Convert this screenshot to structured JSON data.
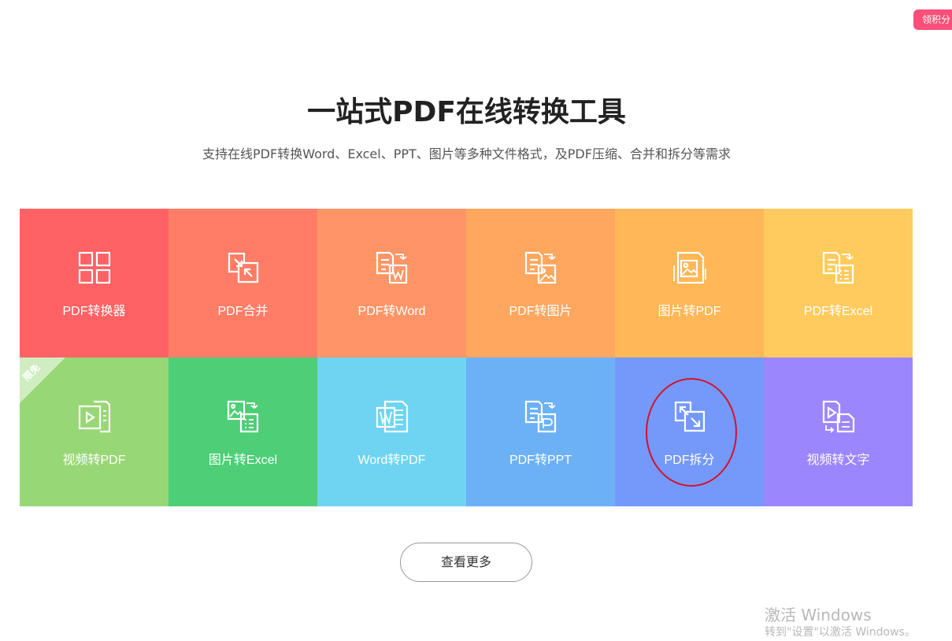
{
  "badge": {
    "label": "领积分"
  },
  "hero": {
    "title": "一站式PDF在线转换工具",
    "subtitle": "支持在线PDF转换Word、Excel、PPT、图片等多种文件格式，及PDF压缩、合并和拆分等需求"
  },
  "tools": [
    {
      "label": "PDF转换器",
      "icon": "grid-icon",
      "color": "#ff6264"
    },
    {
      "label": "PDF合并",
      "icon": "merge-icon",
      "color": "#ff7d67"
    },
    {
      "label": "PDF转Word",
      "icon": "pdf-to-word-icon",
      "color": "#ff9566"
    },
    {
      "label": "PDF转图片",
      "icon": "pdf-to-image-icon",
      "color": "#ffa75f"
    },
    {
      "label": "图片转PDF",
      "icon": "image-to-pdf-icon",
      "color": "#ffb757"
    },
    {
      "label": "PDF转Excel",
      "icon": "pdf-to-excel-icon",
      "color": "#ffcb5f"
    },
    {
      "label": "视频转PDF",
      "icon": "video-to-pdf-icon",
      "color": "#98d775",
      "ribbon": "限免"
    },
    {
      "label": "图片转Excel",
      "icon": "image-to-excel-icon",
      "color": "#4ece76"
    },
    {
      "label": "Word转PDF",
      "icon": "word-to-pdf-icon",
      "color": "#6fd4f2"
    },
    {
      "label": "PDF转PPT",
      "icon": "pdf-to-ppt-icon",
      "color": "#6cb1f6"
    },
    {
      "label": "PDF拆分",
      "icon": "split-icon",
      "color": "#7499fb"
    },
    {
      "label": "视频转文字",
      "icon": "video-to-text-icon",
      "color": "#9c86fd"
    }
  ],
  "more_button": {
    "label": "查看更多"
  },
  "watermark": {
    "title": "激活 Windows",
    "subtitle": "转到\"设置\"以激活 Windows。"
  }
}
